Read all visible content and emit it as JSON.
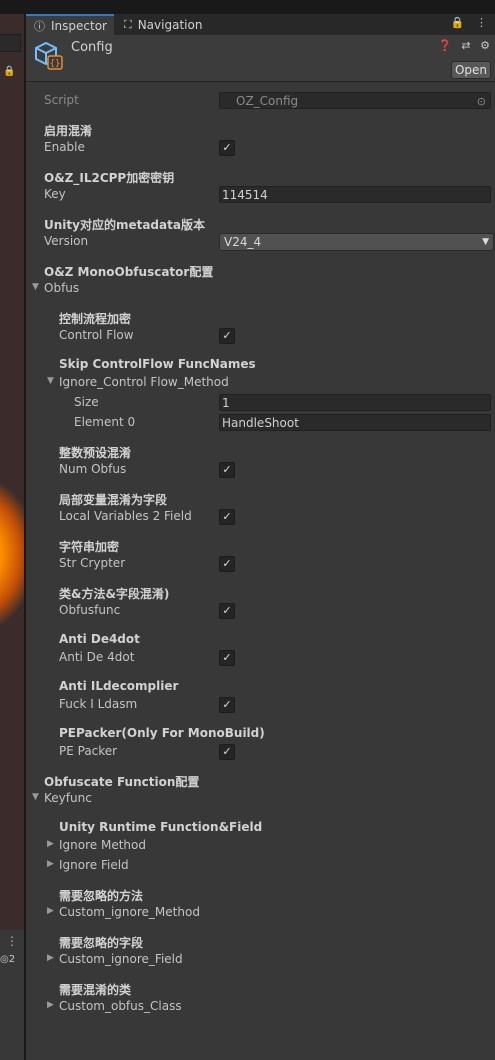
{
  "tabs": {
    "inspector": "Inspector",
    "navigation": "Navigation",
    "right_icons": "🔒 ⋮"
  },
  "header": {
    "title": "Config",
    "help_icons": "❓ ⇄ ⚙",
    "open_label": "Open"
  },
  "left": {
    "count": "◎2"
  },
  "fields": {
    "script_label": "Script",
    "script_value": "OZ_Config",
    "enable_header": "启用混淆",
    "enable_label": "Enable",
    "key_header": "O&Z_IL2CPP加密密钥",
    "key_label": "Key",
    "key_value": "114514",
    "version_header": "Unity对应的metadata版本",
    "version_label": "Version",
    "version_value": "V24_4",
    "obfus_header": "O&Z MonoObfuscator配置",
    "obfus_label": "Obfus",
    "cf_header": "控制流程加密",
    "cf_label": "Control Flow",
    "skip_header": "Skip ControlFlow FuncNames",
    "skip_label": "Ignore_Control Flow_Method",
    "size_label": "Size",
    "size_value": "1",
    "element_label": "Element 0",
    "element_value": "HandleShoot",
    "num_header": "整数预设混淆",
    "num_label": "Num Obfus",
    "local_header": "局部变量混淆为字段",
    "local_label": "Local Variables 2 Field",
    "str_header": "字符串加密",
    "str_label": "Str Crypter",
    "func_header": "类&方法&字段混淆)",
    "func_label": "Obfusfunc",
    "de4_header": "Anti De4dot",
    "de4_label": "Anti De 4dot",
    "ild_header": "Anti ILdecomplier",
    "ild_label": "Fuck I Ldasm",
    "pe_header": "PEPacker(Only For MonoBuild)",
    "pe_label": "PE Packer",
    "keyf_header": "Obfuscate Function配置",
    "keyf_label": "Keyfunc",
    "urf_header": "Unity Runtime Function&Field",
    "ignore_method_label": "Ignore Method",
    "ignore_field_label": "Ignore Field",
    "cim_header": "需要忽略的方法",
    "cim_label": "Custom_ignore_Method",
    "cif_header": "需要忽略的字段",
    "cif_label": "Custom_ignore_Field",
    "coc_header": "需要混淆的类",
    "coc_label": "Custom_obfus_Class"
  },
  "checkbox_states": {
    "enable": true,
    "control_flow": true,
    "num_obfus": true,
    "local_variables": true,
    "str_crypter": true,
    "obfusfunc": true,
    "anti_de4dot": true,
    "fuck_ildasm": true,
    "pe_packer": true
  },
  "colors": {
    "background": "#383838",
    "accent": "#3a79bb",
    "icon_blue": "#6ec0ff",
    "icon_orange": "#f08a2c"
  }
}
